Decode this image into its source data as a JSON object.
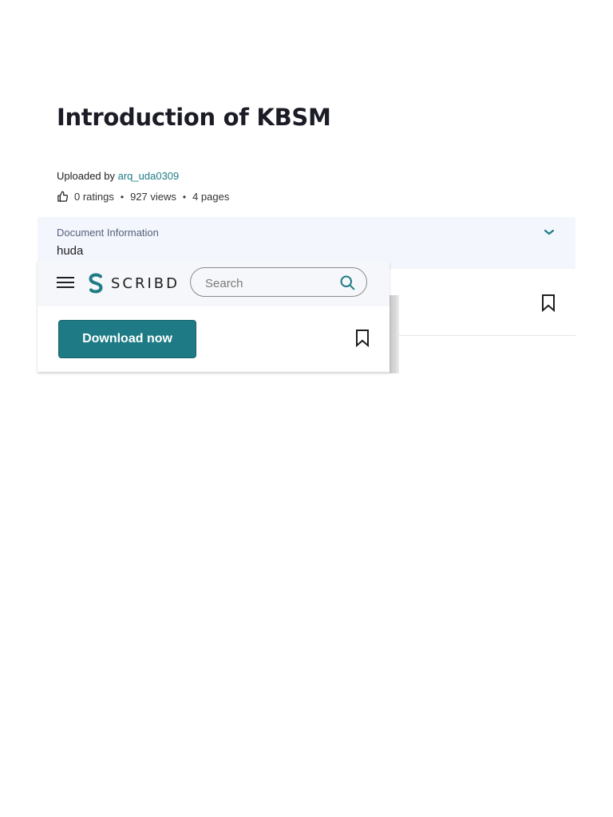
{
  "document": {
    "title": "Introduction of KBSM",
    "uploaded_prefix": "Uploaded by",
    "uploader": "arq_uda0309",
    "ratings": "0 ratings",
    "views": "927 views",
    "pages": "4 pages",
    "separator": "•"
  },
  "info": {
    "label": "Document Information",
    "value": "huda"
  },
  "header": {
    "logo_text": "SCRIBD",
    "search_placeholder": "Search"
  },
  "actions": {
    "download_label": "Download now"
  },
  "colors": {
    "accent": "#1e7b85",
    "info_bg": "#f3f6fd"
  },
  "icons": [
    "thumbs-up-icon",
    "chevron-down-icon",
    "bookmark-icon",
    "menu-icon",
    "scribd-logo-icon",
    "search-icon"
  ]
}
